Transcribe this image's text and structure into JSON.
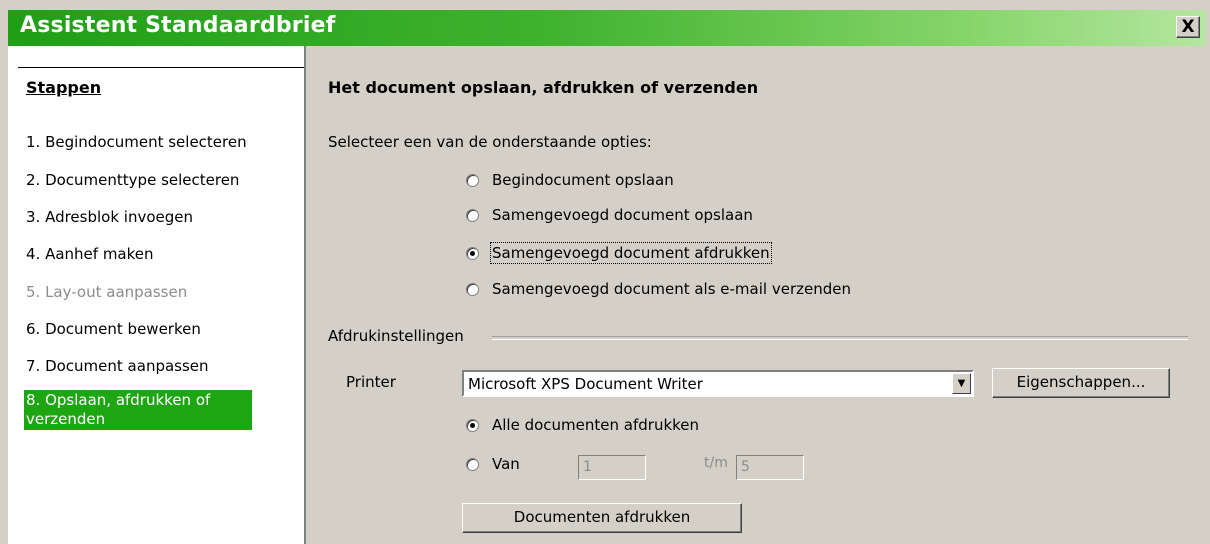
{
  "window": {
    "title": "Assistent Standaardbrief",
    "close_label": "X"
  },
  "steps": {
    "heading": "Stappen",
    "items": [
      {
        "label": "1. Begindocument selecteren",
        "state": "normal"
      },
      {
        "label": "2. Documenttype selecteren",
        "state": "normal"
      },
      {
        "label": "3. Adresblok invoegen",
        "state": "normal"
      },
      {
        "label": "4. Aanhef maken",
        "state": "normal"
      },
      {
        "label": "5. Lay-out aanpassen",
        "state": "disabled"
      },
      {
        "label": "6. Document bewerken",
        "state": "normal"
      },
      {
        "label": "7. Document aanpassen",
        "state": "normal"
      },
      {
        "label": "8. Opslaan, afdrukken of verzenden",
        "state": "active"
      }
    ]
  },
  "main": {
    "title": "Het document opslaan, afdrukken of verzenden",
    "prompt": "Selecteer een van de onderstaande opties:",
    "options": [
      {
        "label": "Begindocument opslaan",
        "selected": false
      },
      {
        "label": "Samengevoegd document opslaan",
        "selected": false
      },
      {
        "label": "Samengevoegd document afdrukken",
        "selected": true
      },
      {
        "label": "Samengevoegd document als e-mail verzenden",
        "selected": false
      }
    ],
    "print_settings": {
      "group_label": "Afdrukinstellingen",
      "printer_label": "Printer",
      "printer_value": "Microsoft XPS Document Writer",
      "properties_button": "Eigenschappen...",
      "all_docs_label": "Alle documenten afdrukken",
      "range_from_label": "Van",
      "range_from_value": "1",
      "range_to_label": "t/m",
      "range_to_value": "5",
      "print_button": "Documenten afdrukken"
    }
  },
  "colors": {
    "accent": "#1ea512",
    "dialog_bg": "#d4d0c8"
  }
}
